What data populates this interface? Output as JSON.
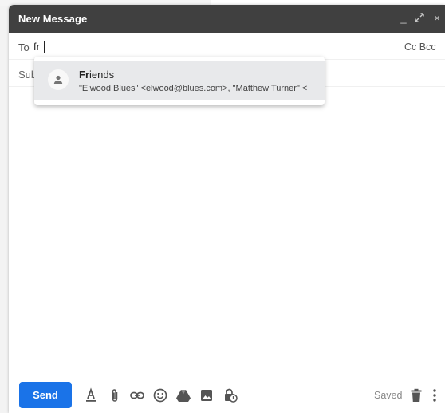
{
  "window": {
    "title": "New Message"
  },
  "titlebar_icons": {
    "minimize": "_",
    "expand": "⤢",
    "close": "×"
  },
  "to": {
    "label": "To",
    "value": "fr",
    "cc_bcc": "Cc Bcc"
  },
  "subject": {
    "label": "Sub"
  },
  "suggestion": {
    "match": "Fr",
    "rest": "iends",
    "detail": "\"Elwood Blues\" <elwood@blues.com>, \"Matthew Turner\" <"
  },
  "footer": {
    "send_label": "Send",
    "status": "Saved"
  },
  "toolbar_icons": [
    "format-text-icon",
    "attach-icon",
    "link-icon",
    "emoji-icon",
    "drive-icon",
    "photo-icon",
    "confidential-icon"
  ],
  "colors": {
    "send": "#1a73e8",
    "titlebar": "#404040",
    "suggestion_bg": "#e8e9eb"
  }
}
